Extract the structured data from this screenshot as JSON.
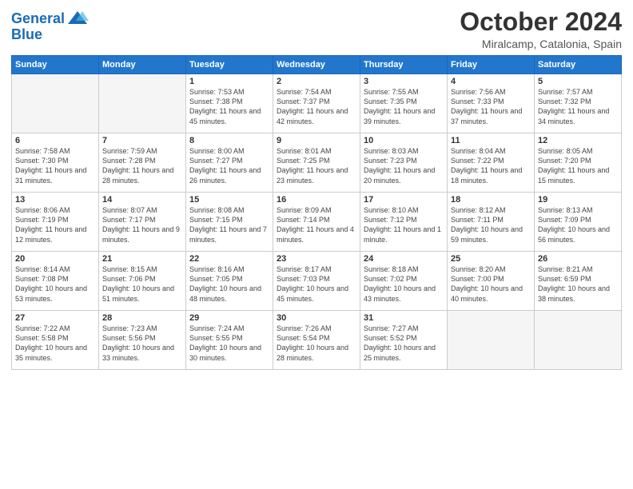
{
  "header": {
    "logo_line1": "General",
    "logo_line2": "Blue",
    "month": "October 2024",
    "location": "Miralcamp, Catalonia, Spain"
  },
  "weekdays": [
    "Sunday",
    "Monday",
    "Tuesday",
    "Wednesday",
    "Thursday",
    "Friday",
    "Saturday"
  ],
  "weeks": [
    [
      {
        "day": "",
        "info": ""
      },
      {
        "day": "",
        "info": ""
      },
      {
        "day": "1",
        "info": "Sunrise: 7:53 AM\nSunset: 7:38 PM\nDaylight: 11 hours and 45 minutes."
      },
      {
        "day": "2",
        "info": "Sunrise: 7:54 AM\nSunset: 7:37 PM\nDaylight: 11 hours and 42 minutes."
      },
      {
        "day": "3",
        "info": "Sunrise: 7:55 AM\nSunset: 7:35 PM\nDaylight: 11 hours and 39 minutes."
      },
      {
        "day": "4",
        "info": "Sunrise: 7:56 AM\nSunset: 7:33 PM\nDaylight: 11 hours and 37 minutes."
      },
      {
        "day": "5",
        "info": "Sunrise: 7:57 AM\nSunset: 7:32 PM\nDaylight: 11 hours and 34 minutes."
      }
    ],
    [
      {
        "day": "6",
        "info": "Sunrise: 7:58 AM\nSunset: 7:30 PM\nDaylight: 11 hours and 31 minutes."
      },
      {
        "day": "7",
        "info": "Sunrise: 7:59 AM\nSunset: 7:28 PM\nDaylight: 11 hours and 28 minutes."
      },
      {
        "day": "8",
        "info": "Sunrise: 8:00 AM\nSunset: 7:27 PM\nDaylight: 11 hours and 26 minutes."
      },
      {
        "day": "9",
        "info": "Sunrise: 8:01 AM\nSunset: 7:25 PM\nDaylight: 11 hours and 23 minutes."
      },
      {
        "day": "10",
        "info": "Sunrise: 8:03 AM\nSunset: 7:23 PM\nDaylight: 11 hours and 20 minutes."
      },
      {
        "day": "11",
        "info": "Sunrise: 8:04 AM\nSunset: 7:22 PM\nDaylight: 11 hours and 18 minutes."
      },
      {
        "day": "12",
        "info": "Sunrise: 8:05 AM\nSunset: 7:20 PM\nDaylight: 11 hours and 15 minutes."
      }
    ],
    [
      {
        "day": "13",
        "info": "Sunrise: 8:06 AM\nSunset: 7:19 PM\nDaylight: 11 hours and 12 minutes."
      },
      {
        "day": "14",
        "info": "Sunrise: 8:07 AM\nSunset: 7:17 PM\nDaylight: 11 hours and 9 minutes."
      },
      {
        "day": "15",
        "info": "Sunrise: 8:08 AM\nSunset: 7:15 PM\nDaylight: 11 hours and 7 minutes."
      },
      {
        "day": "16",
        "info": "Sunrise: 8:09 AM\nSunset: 7:14 PM\nDaylight: 11 hours and 4 minutes."
      },
      {
        "day": "17",
        "info": "Sunrise: 8:10 AM\nSunset: 7:12 PM\nDaylight: 11 hours and 1 minute."
      },
      {
        "day": "18",
        "info": "Sunrise: 8:12 AM\nSunset: 7:11 PM\nDaylight: 10 hours and 59 minutes."
      },
      {
        "day": "19",
        "info": "Sunrise: 8:13 AM\nSunset: 7:09 PM\nDaylight: 10 hours and 56 minutes."
      }
    ],
    [
      {
        "day": "20",
        "info": "Sunrise: 8:14 AM\nSunset: 7:08 PM\nDaylight: 10 hours and 53 minutes."
      },
      {
        "day": "21",
        "info": "Sunrise: 8:15 AM\nSunset: 7:06 PM\nDaylight: 10 hours and 51 minutes."
      },
      {
        "day": "22",
        "info": "Sunrise: 8:16 AM\nSunset: 7:05 PM\nDaylight: 10 hours and 48 minutes."
      },
      {
        "day": "23",
        "info": "Sunrise: 8:17 AM\nSunset: 7:03 PM\nDaylight: 10 hours and 45 minutes."
      },
      {
        "day": "24",
        "info": "Sunrise: 8:18 AM\nSunset: 7:02 PM\nDaylight: 10 hours and 43 minutes."
      },
      {
        "day": "25",
        "info": "Sunrise: 8:20 AM\nSunset: 7:00 PM\nDaylight: 10 hours and 40 minutes."
      },
      {
        "day": "26",
        "info": "Sunrise: 8:21 AM\nSunset: 6:59 PM\nDaylight: 10 hours and 38 minutes."
      }
    ],
    [
      {
        "day": "27",
        "info": "Sunrise: 7:22 AM\nSunset: 5:58 PM\nDaylight: 10 hours and 35 minutes."
      },
      {
        "day": "28",
        "info": "Sunrise: 7:23 AM\nSunset: 5:56 PM\nDaylight: 10 hours and 33 minutes."
      },
      {
        "day": "29",
        "info": "Sunrise: 7:24 AM\nSunset: 5:55 PM\nDaylight: 10 hours and 30 minutes."
      },
      {
        "day": "30",
        "info": "Sunrise: 7:26 AM\nSunset: 5:54 PM\nDaylight: 10 hours and 28 minutes."
      },
      {
        "day": "31",
        "info": "Sunrise: 7:27 AM\nSunset: 5:52 PM\nDaylight: 10 hours and 25 minutes."
      },
      {
        "day": "",
        "info": ""
      },
      {
        "day": "",
        "info": ""
      }
    ]
  ]
}
